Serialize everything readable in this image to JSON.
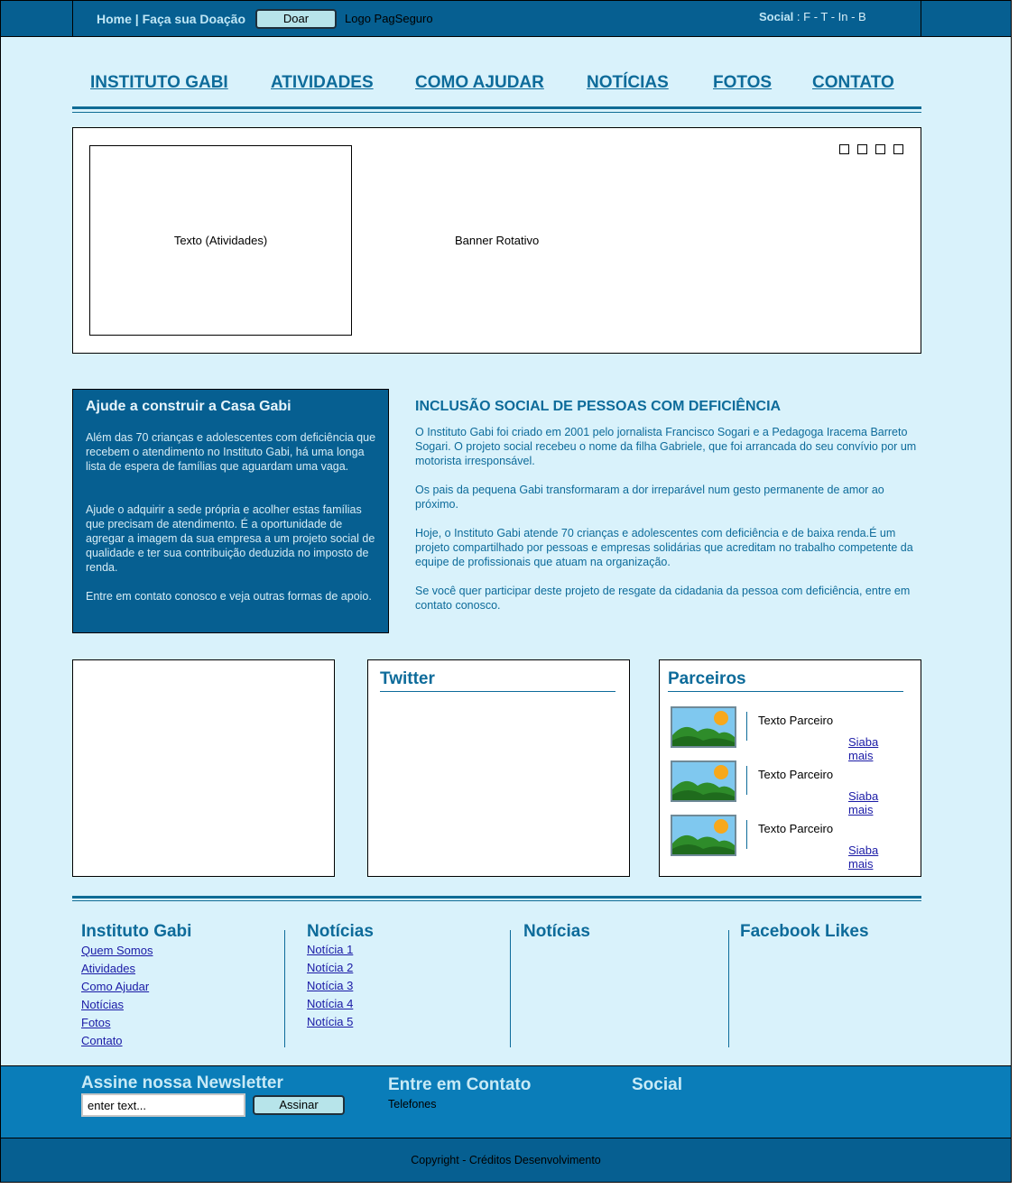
{
  "topbar": {
    "home_link": "Home",
    "separator": "|",
    "donate_link": "Faça sua Doação",
    "donate_button": "Doar",
    "logo": "Logo PagSeguro",
    "social_label": "Social",
    "social_links": ": F - T - In - B"
  },
  "nav": {
    "items": [
      "INSTITUTO GABI",
      "ATIVIDADES",
      "COMO AJUDAR",
      "NOTÍCIAS",
      "FOTOS",
      "CONTATO"
    ]
  },
  "banner": {
    "text_box": "Texto (Atividades)",
    "label": "Banner Rotativo"
  },
  "help": {
    "title": "Ajude a construir a Casa Gabi",
    "paragraphs": [
      "Além das 70 crianças e adolescentes com deficiência que recebem o atendimento no Instituto Gabi, há uma longa lista de espera de famílias que aguardam uma vaga.",
      "Ajude o adquirir a sede própria e acolher estas famílias que precisam de atendimento. É a oportunidade de agregar a imagem da sua empresa a um projeto social de qualidade e ter sua contribuição deduzida no imposto de renda.",
      "Entre em contato conosco e veja outras formas de apoio."
    ]
  },
  "inclusion": {
    "title": "INCLUSÃO SOCIAL DE PESSOAS COM DEFICIÊNCIA",
    "paragraphs": [
      "O Instituto Gabi foi criado em 2001 pelo jornalista Francisco Sogari e a Pedagoga Iracema Barreto Sogari. O projeto social recebeu o nome da filha Gabriele, que foi arrancada do seu convívio por um motorista irresponsável.",
      "Os pais da pequena Gabi transformaram a dor irreparável num gesto permanente de amor ao próximo.",
      "Hoje, o Instituto Gabi atende 70 crianças e adolescentes com deficiência e de baixa renda.É um projeto compartilhado por pessoas e empresas solidárias que acreditam no trabalho competente da equipe de profissionais que atuam na organização.",
      "Se você quer participar deste projeto de resgate da cidadania da pessoa com deficiência, entre em contato conosco."
    ]
  },
  "twitter": {
    "title": "Twitter"
  },
  "partners": {
    "title": "Parceiros",
    "items": [
      {
        "text": "Texto Parceiro",
        "link": "Siaba mais"
      },
      {
        "text": "Texto Parceiro",
        "link": "Siaba mais"
      },
      {
        "text": "Texto Parceiro",
        "link": "Siaba mais"
      }
    ]
  },
  "footer": {
    "col1": {
      "title": "Instituto Gabi",
      "links": [
        "Quem Somos",
        "Atividades",
        "Como Ajudar",
        "Notícias",
        "Fotos",
        "Contato"
      ]
    },
    "col2": {
      "title": "Notícias",
      "links": [
        "Notícia 1",
        "Notícia 2",
        "Notícia 3",
        "Notícia 4",
        "Notícia 5"
      ]
    },
    "col3": {
      "title": "Notícias"
    },
    "col4": {
      "title": "Facebook Likes"
    }
  },
  "newsletter": {
    "title": "Assine nossa Newsletter",
    "input_value": "enter text...",
    "button": "Assinar"
  },
  "contact": {
    "title": "Entre em Contato",
    "phones": "Telefones"
  },
  "social_footer": {
    "title": "Social"
  },
  "copyright": "Copyright - Créditos Desenvolvimento",
  "colors": {
    "dark_blue": "#065f91",
    "bright_blue": "#0a7db9",
    "page_bg": "#d9f2fb",
    "accent_text": "#0d6b9a"
  }
}
